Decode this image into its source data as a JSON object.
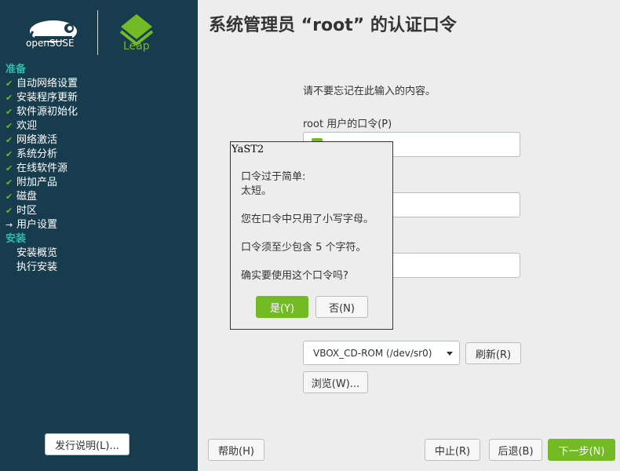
{
  "sidebar": {
    "logo_text": "openSUSE",
    "leap_text": "Leap",
    "stages": [
      {
        "label": "准备",
        "steps": [
          {
            "label": "自动网络设置",
            "status": "done"
          },
          {
            "label": "安装程序更新",
            "status": "done"
          },
          {
            "label": "软件源初始化",
            "status": "done"
          },
          {
            "label": "欢迎",
            "status": "done"
          },
          {
            "label": "网络激活",
            "status": "done"
          },
          {
            "label": "系统分析",
            "status": "done"
          },
          {
            "label": "在线软件源",
            "status": "done"
          },
          {
            "label": "附加产品",
            "status": "done"
          },
          {
            "label": "磁盘",
            "status": "done"
          },
          {
            "label": "时区",
            "status": "done"
          },
          {
            "label": "用户设置",
            "status": "current"
          }
        ]
      },
      {
        "label": "安装",
        "steps": [
          {
            "label": "安装概览",
            "status": "pending"
          },
          {
            "label": "执行安装",
            "status": "pending"
          }
        ]
      }
    ],
    "release_notes_button": "发行说明(L)..."
  },
  "main": {
    "title": "系统管理员 “root” 的认证口令",
    "hint": "请不要忘记在此输入的内容。",
    "password_label": "root 用户的口令(P)",
    "combo_value": "VBOX_CD-ROM (/dev/sr0)",
    "refresh_button": "刷新(R)",
    "browse_button": "浏览(W)..."
  },
  "footer": {
    "help": "帮助(H)",
    "abort": "中止(R)",
    "back": "后退(B)",
    "next": "下一步(N)"
  },
  "dialog": {
    "title": "YaST2",
    "lines": [
      "口令过于简单:",
      "太短。"
    ],
    "line_lowercase": "您在口令中只用了小写字母。",
    "line_minchars": "口令须至少包含 5 个字符。",
    "question": "确实要使用这个口令吗?",
    "yes": "是(Y)",
    "no": "否(N)"
  },
  "colors": {
    "sidebar_bg": "#173c4d",
    "accent_green": "#73ba25",
    "stage_teal": "#35b9ab"
  }
}
